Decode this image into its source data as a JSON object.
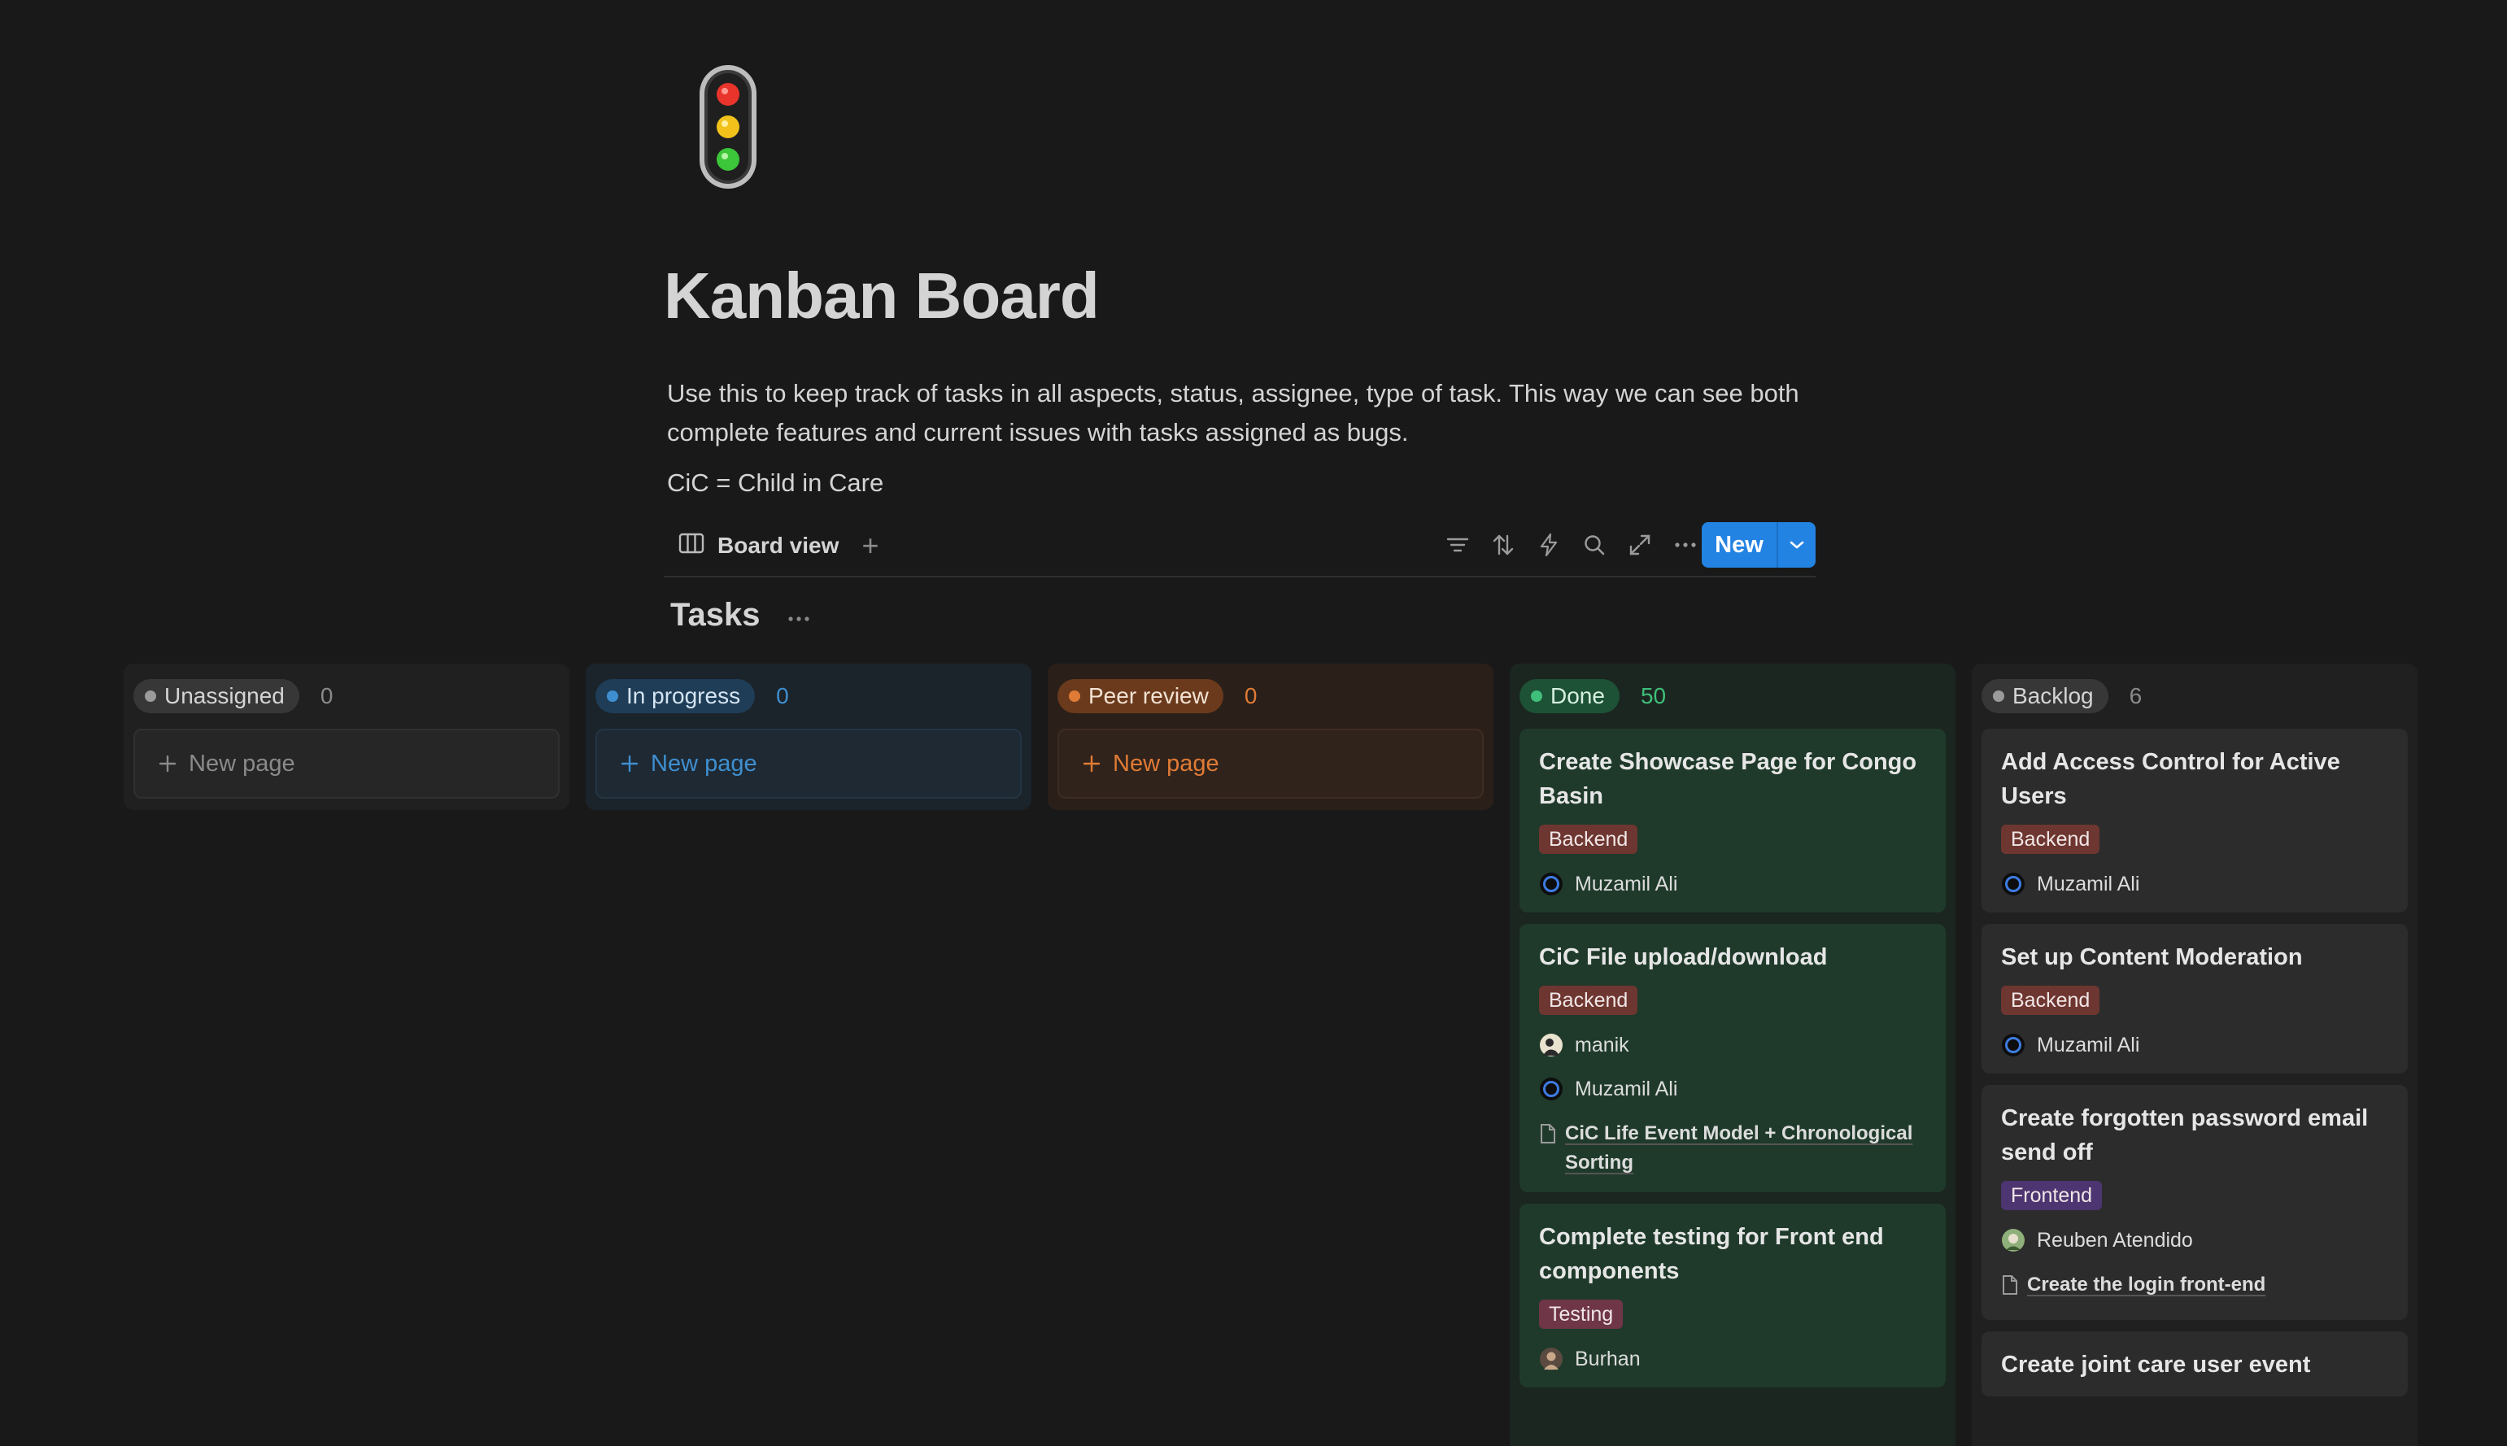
{
  "page": {
    "icon": "traffic-light-icon",
    "title": "Kanban Board",
    "description": "Use this to keep track of tasks in all aspects, status, assignee, type of task. This way we can see both complete features and current issues with tasks assigned as bugs.",
    "note": "CiC = Child in Care"
  },
  "toolbar": {
    "view_label": "Board view",
    "view_icon": "board-view-icon",
    "add_view": "+",
    "icons": [
      "filter-icon",
      "sort-icon",
      "automation-lightning-icon",
      "search-icon",
      "expand-icon",
      "more-icon"
    ],
    "new_label": "New"
  },
  "database": {
    "title": "Tasks",
    "more": "···"
  },
  "columns": [
    {
      "name": "Unassigned",
      "count": "0",
      "colors": {
        "pill_bg": "#373737",
        "dot": "#9b9b9b",
        "text": "#d4d4d4",
        "count": "#8a8a8a",
        "col_bg": "#202020",
        "new_bg": "#262626",
        "new_border": "#303030"
      },
      "new_page": "New page"
    },
    {
      "name": "In progress",
      "count": "0",
      "colors": {
        "pill_bg": "#1f3d57",
        "dot": "#3f8fd0",
        "text": "#d4e4f2",
        "count": "#3f8fd0",
        "col_bg": "#1b232b",
        "new_bg": "#1e2933",
        "new_border": "#243544"
      },
      "new_page": "New page"
    },
    {
      "name": "Peer review",
      "count": "0",
      "colors": {
        "pill_bg": "#6b3a1c",
        "dot": "#e07b35",
        "text": "#f2e2d4",
        "count": "#e07b35",
        "col_bg": "#2a1f19",
        "new_bg": "#30231c",
        "new_border": "#3e2c21"
      },
      "new_page": "New page"
    },
    {
      "name": "Done",
      "count": "50",
      "colors": {
        "pill_bg": "#1d5236",
        "dot": "#3fbf7a",
        "text": "#d6efe0",
        "count": "#3fbf7a",
        "col_bg": "#1b2620",
        "card_bg": "#1f3a2b"
      },
      "cards": [
        {
          "title": "Create Showcase Page for Congo Basin",
          "tag": "Backend",
          "tag_type": "backend",
          "people": [
            {
              "name": "Muzamil Ali",
              "avatar": "ring"
            }
          ]
        },
        {
          "title": "CiC File upload/download",
          "tag": "Backend",
          "tag_type": "backend",
          "people": [
            {
              "name": "manik",
              "avatar": "photo-light"
            },
            {
              "name": "Muzamil Ali",
              "avatar": "ring"
            }
          ],
          "relation": "CiC Life Event Model + Chronological Sorting"
        },
        {
          "title": "Complete testing for Front end components",
          "tag": "Testing",
          "tag_type": "testing",
          "people": [
            {
              "name": "Burhan",
              "avatar": "photo-dark"
            }
          ]
        }
      ]
    },
    {
      "name": "Backlog",
      "count": "6",
      "colors": {
        "pill_bg": "#373737",
        "dot": "#9b9b9b",
        "text": "#d4d4d4",
        "count": "#8a8a8a",
        "col_bg": "#202020",
        "card_bg": "#2c2c2c"
      },
      "cards": [
        {
          "title": "Add Access Control for Active Users",
          "tag": "Backend",
          "tag_type": "backend",
          "people": [
            {
              "name": "Muzamil Ali",
              "avatar": "ring"
            }
          ]
        },
        {
          "title": "Set up Content Moderation",
          "tag": "Backend",
          "tag_type": "backend",
          "people": [
            {
              "name": "Muzamil Ali",
              "avatar": "ring"
            }
          ]
        },
        {
          "title": "Create forgotten password email send off",
          "tag": "Frontend",
          "tag_type": "frontend",
          "people": [
            {
              "name": "Reuben Atendido",
              "avatar": "photo-green"
            }
          ],
          "relation": "Create the login front-end"
        },
        {
          "title": "Create joint care user event",
          "people": []
        }
      ]
    }
  ]
}
